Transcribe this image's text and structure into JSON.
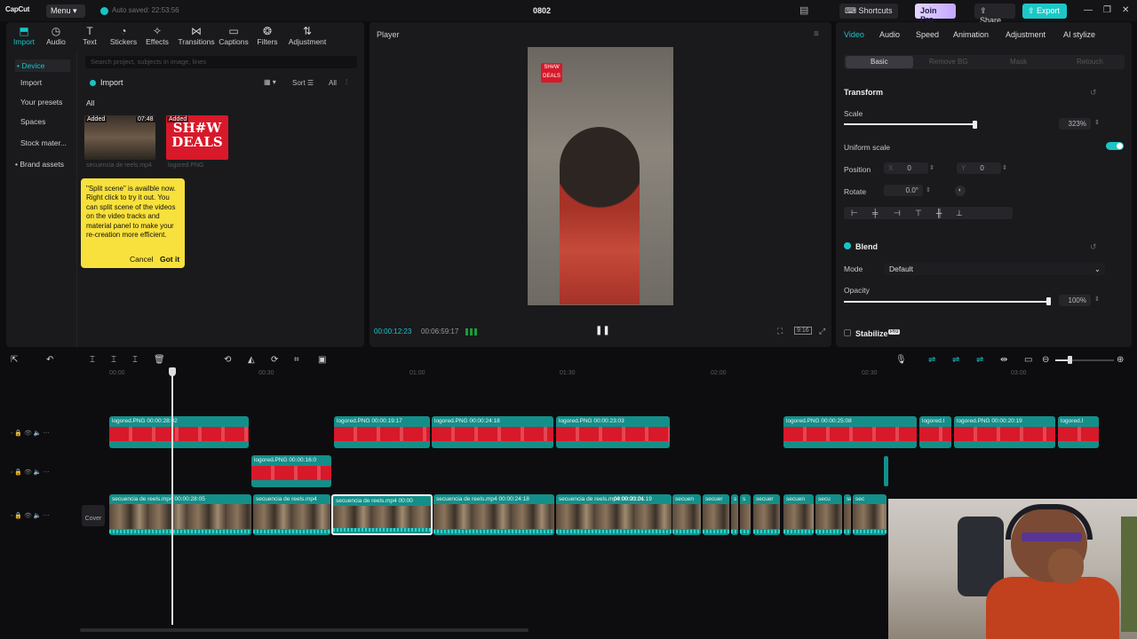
{
  "topbar": {
    "logo": "CapCut",
    "menu_label": "Menu ▾",
    "autosave": "Auto saved: 22:53:56",
    "project_title": "0802",
    "shortcuts": "Shortcuts",
    "join_pro": "Join Pro",
    "share": "Share",
    "export": "Export"
  },
  "media": {
    "tools": [
      "Import",
      "Audio",
      "Text",
      "Stickers",
      "Effects",
      "Transitions",
      "Captions",
      "Filters",
      "Adjustment"
    ],
    "side_items": [
      "• Device",
      "Import",
      "Your presets",
      "Spaces",
      "Stock mater...",
      "• Brand assets"
    ],
    "search_placeholder": "Search project, subjects in image, lines",
    "import_button": "Import",
    "sort": "Sort",
    "all_filter": "All",
    "all_label": "All",
    "thumbs": [
      {
        "tag": "Added",
        "duration": "07:48",
        "name": "secuencia de reels.mp4"
      },
      {
        "tag": "Added",
        "name": "logored.PNG",
        "art": "SH#W DEALS"
      }
    ],
    "tip": {
      "text": "\"Split scene\" is availble now. Right click to try it out. You can split scene of the videos on the video tracks and material panel to make your re-creation more efficient.",
      "cancel": "Cancel",
      "got_it": "Got it"
    }
  },
  "player": {
    "title": "Player",
    "overlay_logo": "SH#W DEALS",
    "time_current": "00:00:12:23",
    "time_total": "00:06:59:17",
    "ratio": "9:16"
  },
  "props": {
    "tabs": [
      "Video",
      "Audio",
      "Speed",
      "Animation",
      "Adjustment",
      "AI stylize"
    ],
    "subtabs": [
      "Basic",
      "Remove BG",
      "Mask",
      "Retouch"
    ],
    "transform_label": "Transform",
    "scale_label": "Scale",
    "scale_value": "323%",
    "scale_fraction": 0.98,
    "uniform_label": "Uniform scale",
    "position_label": "Position",
    "pos_x_label": "X",
    "pos_x": "0",
    "pos_y_label": "Y",
    "pos_y": "0",
    "rotate_label": "Rotate",
    "rotate_value": "0.0°",
    "blend_label": "Blend",
    "mode_label": "Mode",
    "mode_value": "Default",
    "opacity_label": "Opacity",
    "opacity_value": "100%",
    "opacity_fraction": 1.0,
    "stabilize_label": "Stabilize",
    "pro_badge": "Pro"
  },
  "timeline": {
    "ruler": [
      "00:00",
      "00:30",
      "01:00",
      "01:30",
      "02:00",
      "02:30",
      "03:00"
    ],
    "cover_label": "Cover",
    "overlay_clips": [
      {
        "name": "logored.PNG",
        "dur": "00:00:28:02"
      },
      {
        "name": "logored.PNG",
        "dur": "00:00:19:17"
      },
      {
        "name": "logored.PNG",
        "dur": "00:00:24:18"
      },
      {
        "name": "logored.PNG",
        "dur": "00:00:23:03"
      },
      {
        "name": "logored.PNG",
        "dur": "00:00:25:08"
      },
      {
        "name": "logored.I",
        "dur": ""
      },
      {
        "name": "logored.PNG",
        "dur": "00:00:20:19"
      },
      {
        "name": "logored.I",
        "dur": ""
      }
    ],
    "second_clip": {
      "name": "logored.PNG",
      "dur": "00:00:16:0"
    },
    "main_clips": [
      {
        "name": "secuencia de reels.mp4",
        "dur": "00:00:28:05"
      },
      {
        "name": "secuencia de reels.mp4",
        "dur": "00:00"
      },
      {
        "name": "secuencia de reels.mp4",
        "dur": "00:00:24:18"
      },
      {
        "name": "secuencia de reels.mp4",
        "dur": "00:00:24:19"
      },
      {
        "name": "secuencia de reels.mp4",
        "dur": "00:00:23:01"
      },
      {
        "name": "secuen",
        "dur": ""
      },
      {
        "name": "secuer",
        "dur": ""
      },
      {
        "name": "s",
        "dur": ""
      },
      {
        "name": "s",
        "dur": ""
      },
      {
        "name": "secuer",
        "dur": ""
      },
      {
        "name": "secuen",
        "dur": ""
      },
      {
        "name": "secu",
        "dur": ""
      },
      {
        "name": "se",
        "dur": ""
      },
      {
        "name": "sec",
        "dur": ""
      }
    ]
  }
}
